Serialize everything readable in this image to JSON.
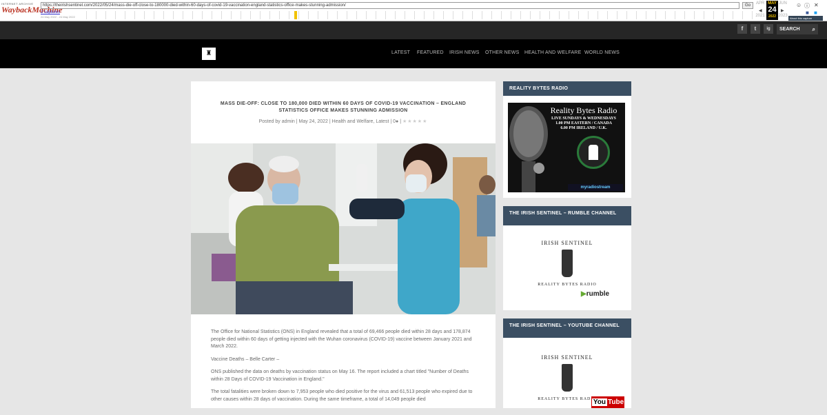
{
  "wayback": {
    "logo_top": "INTERNET ARCHIVE",
    "logo_main": "WaybackMachine",
    "url": "https://theirishsentinel.com/2022/05/24/mass-die-off-close-to-180000-died-within-60-days-of-covid-19-vaccination-england-statistics-office-makes-stunning-admission/",
    "go_label": "Go",
    "captures": "2 captures",
    "range": "24 May 2022 - 24 May 2022",
    "prev_month": "APR",
    "cur_month": "MAY",
    "cur_day": "24",
    "cur_year": "2022",
    "next_month": "JUN",
    "prev_year": "2021",
    "next_year": "2023",
    "about": "About this capture"
  },
  "topbar": {
    "social": [
      "f",
      "t",
      "ig"
    ],
    "search_label": "SEARCH"
  },
  "nav": {
    "items": [
      "LATEST",
      "FEATURED",
      "IRISH NEWS",
      "OTHER NEWS",
      "HEALTH AND WELFARE",
      "WORLD NEWS"
    ]
  },
  "post": {
    "title": "MASS DIE-OFF: CLOSE TO 180,000 DIED WITHIN 60 DAYS OF COVID-19 VACCINATION – ENGLAND STATISTICS OFFICE MAKES STUNNING ADMISSION",
    "meta_posted": "Posted by admin",
    "meta_date": "May 24, 2022",
    "meta_categories": "Health and Welfare, Latest",
    "meta_comments": "0",
    "paragraphs": [
      "The Office for National Statistics (ONS) in England revealed that a total of 69,466 people died within 28 days and 178,874 people died within 60 days of getting injected with the Wuhan coronavirus (COVID-19) vaccine between January 2021 and March 2022.",
      "Vaccine Deaths – Belle Carter –",
      "ONS published the data on deaths by vaccination status on May 16. The report included a chart titled \"Number of Deaths within 28 Days of COVID-19 Vaccination in England.\"",
      "The total fatalities were broken down to 7,953 people who died positive for the virus and 61,513 people who expired due to other causes within 28 days of vaccination. During the same timeframe, a total of 14,049 people died"
    ]
  },
  "sidebar": {
    "radio_heading": "REALITY BYTES RADIO",
    "radio_title": "Reality Bytes Radio",
    "radio_line1": "LIVE SUNDAYS & WEDNESDAYS",
    "radio_line2": "1.00 PM EASTERN / CANADA",
    "radio_line3": "6.00 PM IRELAND / U.K.",
    "radio_footer": "myradiostream",
    "rumble_heading": "THE IRISH SENTINEL – RUMBLE CHANNEL",
    "seal_top": "IRISH SENTINEL",
    "seal_bottom": "REALITY BYTES RADIO",
    "rumble_logo": "rumble",
    "youtube_heading": "THE IRISH SENTINEL – YOUTUBE CHANNEL",
    "youtube_you": "You",
    "youtube_tube": "Tube"
  }
}
